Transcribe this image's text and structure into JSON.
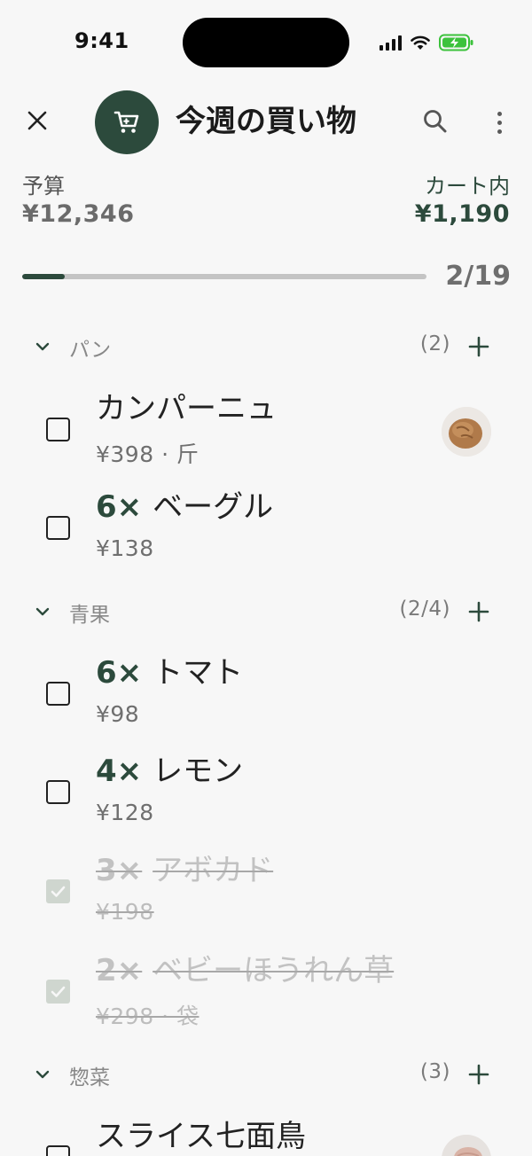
{
  "status_bar": {
    "time": "9:41"
  },
  "header": {
    "title": "今週の買い物",
    "close_icon": "close-icon",
    "cart_icon": "cart-icon",
    "search_icon": "search-icon",
    "more_icon": "more-vertical-icon"
  },
  "summary": {
    "budget_label": "予算",
    "budget_value": "¥12,346",
    "cart_label": "カート内",
    "cart_value": "¥1,190",
    "progress_count": "2/19",
    "progress_checked": 2,
    "progress_total": 19
  },
  "sections": [
    {
      "title": "パン",
      "count": "(2)",
      "items": [
        {
          "qty": "",
          "name": "カンパーニュ",
          "price": "¥398 · 斤",
          "checked": false,
          "thumbnail": "bread-thumbnail"
        },
        {
          "qty": "6×",
          "name": "ベーグル",
          "price": "¥138",
          "checked": false
        }
      ]
    },
    {
      "title": "青果",
      "count": "(2/4)",
      "items": [
        {
          "qty": "6×",
          "name": "トマト",
          "price": "¥98",
          "checked": false
        },
        {
          "qty": "4×",
          "name": "レモン",
          "price": "¥128",
          "checked": false
        },
        {
          "qty": "3×",
          "name": "アボカド",
          "price": "¥198",
          "checked": true
        },
        {
          "qty": "2×",
          "name": "ベビーほうれん草",
          "price": "¥298 · 袋",
          "checked": true
        }
      ]
    },
    {
      "title": "惣菜",
      "count": "(3)",
      "items": [
        {
          "qty": "",
          "name": "スライス七面鳥",
          "price": "",
          "checked": false,
          "thumbnail": "turkey-thumbnail"
        }
      ]
    }
  ],
  "colors": {
    "accent": "#2c4a3c",
    "background": "#f7f7f7",
    "track": "#c4c4c4",
    "muted": "#888888",
    "battery": "#3cc23c"
  }
}
